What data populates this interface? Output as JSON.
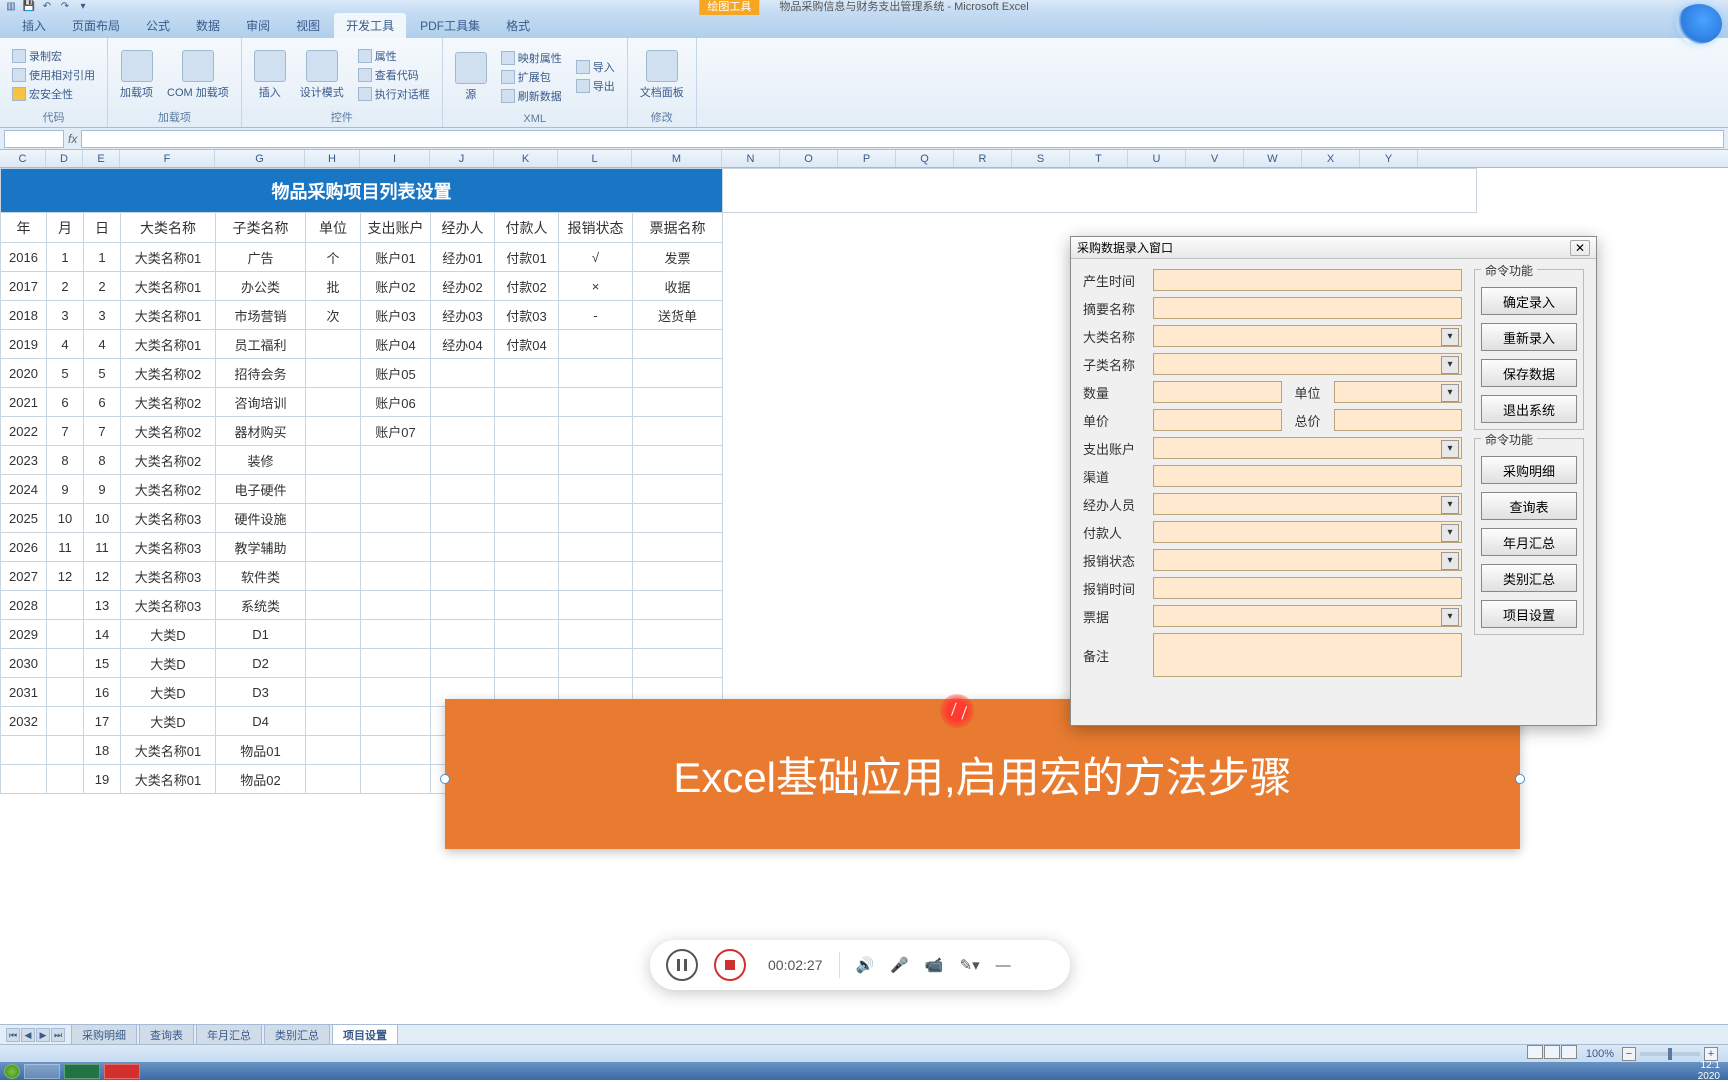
{
  "app": {
    "context_tab": "绘图工具",
    "doc_title": "物品采购信息与财务支出管理系统 - Microsoft Excel"
  },
  "tabs": [
    "插入",
    "页面布局",
    "公式",
    "数据",
    "审阅",
    "视图",
    "开发工具",
    "PDF工具集",
    "格式"
  ],
  "active_tab": "开发工具",
  "ribbon": {
    "group1": {
      "label": "代码",
      "record_macro": "录制宏",
      "relative_ref": "使用相对引用",
      "macro_security": "宏安全性"
    },
    "group2": {
      "label": "加载项",
      "addins": "加载项",
      "com_addins": "COM 加载项"
    },
    "group3": {
      "label": "控件",
      "insert": "插入",
      "design_mode": "设计模式",
      "properties": "属性",
      "view_code": "查看代码",
      "run_dialog": "执行对话框"
    },
    "group4": {
      "label": "XML",
      "source": "源",
      "map_props": "映射属性",
      "expand_pack": "扩展包",
      "refresh": "刷新数据",
      "import": "导入",
      "export": "导出"
    },
    "group5": {
      "label": "修改",
      "doc_panel": "文档面板"
    }
  },
  "columns": [
    "C",
    "D",
    "E",
    "F",
    "G",
    "H",
    "I",
    "J",
    "K",
    "L",
    "M",
    "N",
    "O",
    "P",
    "Q",
    "R",
    "S",
    "T",
    "U",
    "V",
    "W",
    "X",
    "Y"
  ],
  "sheet": {
    "title": "物品采购项目列表设置",
    "headers": [
      "年",
      "月",
      "日",
      "大类名称",
      "子类名称",
      "单位",
      "支出账户",
      "经办人",
      "付款人",
      "报销状态",
      "票据名称"
    ],
    "rows": [
      [
        "2016",
        "1",
        "1",
        "大类名称01",
        "广告",
        "个",
        "账户01",
        "经办01",
        "付款01",
        "√",
        "发票"
      ],
      [
        "2017",
        "2",
        "2",
        "大类名称01",
        "办公类",
        "批",
        "账户02",
        "经办02",
        "付款02",
        "×",
        "收据"
      ],
      [
        "2018",
        "3",
        "3",
        "大类名称01",
        "市场营销",
        "次",
        "账户03",
        "经办03",
        "付款03",
        "-",
        "送货单"
      ],
      [
        "2019",
        "4",
        "4",
        "大类名称01",
        "员工福利",
        "",
        "账户04",
        "经办04",
        "付款04",
        "",
        ""
      ],
      [
        "2020",
        "5",
        "5",
        "大类名称02",
        "招待会务",
        "",
        "账户05",
        "",
        "",
        "",
        ""
      ],
      [
        "2021",
        "6",
        "6",
        "大类名称02",
        "咨询培训",
        "",
        "账户06",
        "",
        "",
        "",
        ""
      ],
      [
        "2022",
        "7",
        "7",
        "大类名称02",
        "器材购买",
        "",
        "账户07",
        "",
        "",
        "",
        ""
      ],
      [
        "2023",
        "8",
        "8",
        "大类名称02",
        "装修",
        "",
        "",
        "",
        "",
        "",
        ""
      ],
      [
        "2024",
        "9",
        "9",
        "大类名称02",
        "电子硬件",
        "",
        "",
        "",
        "",
        "",
        ""
      ],
      [
        "2025",
        "10",
        "10",
        "大类名称03",
        "硬件设施",
        "",
        "",
        "",
        "",
        "",
        ""
      ],
      [
        "2026",
        "11",
        "11",
        "大类名称03",
        "教学辅助",
        "",
        "",
        "",
        "",
        "",
        ""
      ],
      [
        "2027",
        "12",
        "12",
        "大类名称03",
        "软件类",
        "",
        "",
        "",
        "",
        "",
        ""
      ],
      [
        "2028",
        "",
        "13",
        "大类名称03",
        "系统类",
        "",
        "",
        "",
        "",
        "",
        ""
      ],
      [
        "2029",
        "",
        "14",
        "大类D",
        "D1",
        "",
        "",
        "",
        "",
        "",
        ""
      ],
      [
        "2030",
        "",
        "15",
        "大类D",
        "D2",
        "",
        "",
        "",
        "",
        "",
        ""
      ],
      [
        "2031",
        "",
        "16",
        "大类D",
        "D3",
        "",
        "",
        "",
        "",
        "",
        ""
      ],
      [
        "2032",
        "",
        "17",
        "大类D",
        "D4",
        "",
        "",
        "",
        "",
        "",
        ""
      ],
      [
        "",
        "",
        "18",
        "大类名称01",
        "物品01",
        "",
        "",
        "",
        "",
        "",
        ""
      ],
      [
        "",
        "",
        "19",
        "大类名称01",
        "物品02",
        "",
        "",
        "",
        "",
        "",
        ""
      ]
    ]
  },
  "userform": {
    "title": "采购数据录入窗口",
    "fieldset1": "命令功能",
    "fieldset2": "命令功能",
    "labels": {
      "time": "产生时间",
      "summary": "摘要名称",
      "cat": "大类名称",
      "subcat": "子类名称",
      "qty": "数量",
      "unit": "单位",
      "price": "单价",
      "total": "总价",
      "account": "支出账户",
      "channel": "渠道",
      "handler": "经办人员",
      "payer": "付款人",
      "reimburse": "报销状态",
      "reimb_time": "报销时间",
      "voucher": "票据",
      "remark": "备注"
    },
    "buttons": {
      "confirm": "确定录入",
      "reset": "重新录入",
      "save": "保存数据",
      "exit": "退出系统",
      "detail": "采购明细",
      "query": "查询表",
      "yearly": "年月汇总",
      "category": "类别汇总",
      "project": "项目设置"
    }
  },
  "banner": "Excel基础应用,启用宏的方法步骤",
  "recording": {
    "time": "00:02:27"
  },
  "sheet_tabs": [
    "采购明细",
    "查询表",
    "年月汇总",
    "类别汇总",
    "项目设置"
  ],
  "active_sheet": "项目设置",
  "status": {
    "zoom": "100%"
  },
  "taskbar": {
    "time": "12:1",
    "date": "2020"
  }
}
